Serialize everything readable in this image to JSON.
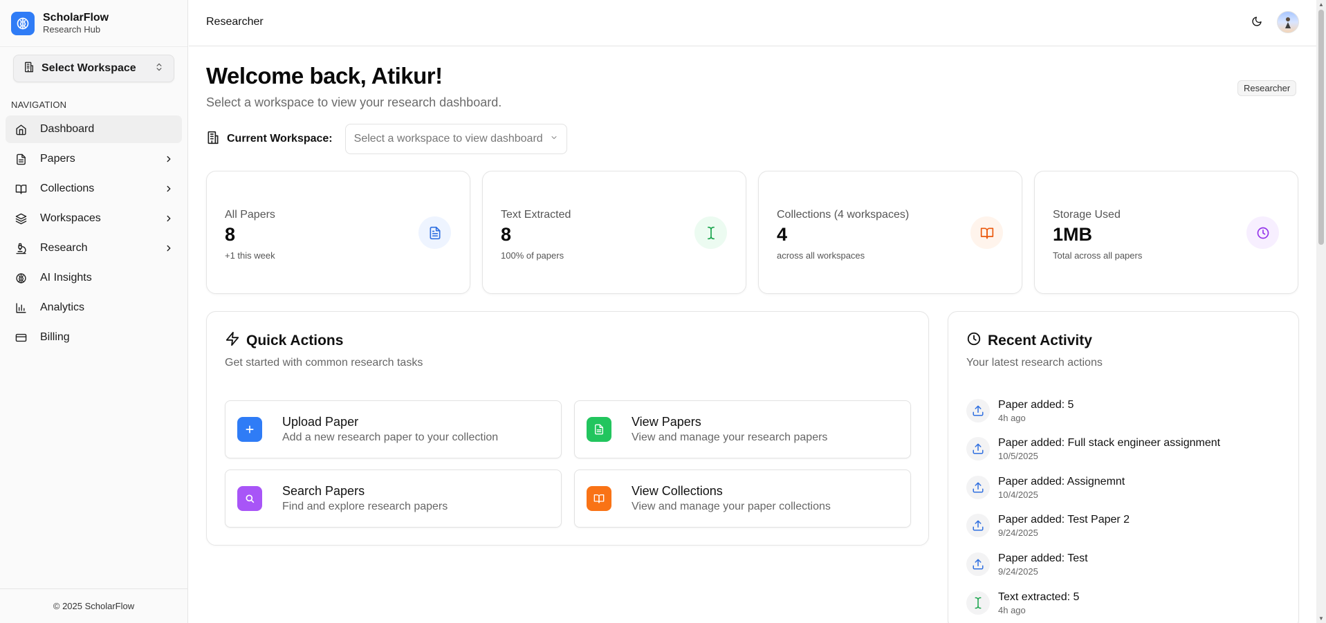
{
  "brand": {
    "name": "ScholarFlow",
    "subtitle": "Research Hub",
    "logo_icon": "brain-icon",
    "accent": "#2f7cf6"
  },
  "sidebar": {
    "workspace_select": "Select Workspace",
    "nav_heading": "NAVIGATION",
    "items": [
      {
        "label": "Dashboard",
        "icon": "home-icon",
        "active": true
      },
      {
        "label": "Papers",
        "icon": "file-icon",
        "expandable": true
      },
      {
        "label": "Collections",
        "icon": "book-icon",
        "expandable": true
      },
      {
        "label": "Workspaces",
        "icon": "layers-icon",
        "expandable": true
      },
      {
        "label": "Research",
        "icon": "microscope-icon",
        "expandable": true
      },
      {
        "label": "AI Insights",
        "icon": "brain-icon"
      },
      {
        "label": "Analytics",
        "icon": "bar-chart-icon"
      },
      {
        "label": "Billing",
        "icon": "credit-card-icon"
      }
    ],
    "footer": "© 2025 ScholarFlow"
  },
  "header": {
    "title": "Researcher",
    "theme_icon": "moon-icon"
  },
  "main": {
    "welcome": "Welcome back, Atikur!",
    "subtitle": "Select a workspace to view your research dashboard.",
    "role_badge": "Researcher",
    "current_workspace_label": "Current Workspace:",
    "current_workspace_placeholder": "Select a workspace to view dashboard",
    "stats": [
      {
        "label": "All Papers",
        "value": "8",
        "sub": "+1 this week",
        "icon": "file-text-icon",
        "color": "#2f6fe0",
        "bg": "#eef4ff"
      },
      {
        "label": "Text Extracted",
        "value": "8",
        "sub": "100% of papers",
        "icon": "text-cursor-icon",
        "color": "#16a34a",
        "bg": "#ecfbf1"
      },
      {
        "label": "Collections (4 workspaces)",
        "value": "4",
        "sub": "across all workspaces",
        "icon": "book-open-icon",
        "color": "#ea580c",
        "bg": "#fff4ec"
      },
      {
        "label": "Storage Used",
        "value": "1MB",
        "sub": "Total across all papers",
        "icon": "clock-icon",
        "color": "#9333ea",
        "bg": "#f7efff"
      }
    ],
    "quick_actions": {
      "title": "Quick Actions",
      "subtitle": "Get started with common research tasks",
      "items": [
        {
          "title": "Upload Paper",
          "desc": "Add a new research paper to your collection",
          "icon": "plus-icon",
          "color": "#2f7cf6"
        },
        {
          "title": "View Papers",
          "desc": "View and manage your research papers",
          "icon": "file-text-icon",
          "color": "#22c55e"
        },
        {
          "title": "Search Papers",
          "desc": "Find and explore research papers",
          "icon": "search-icon",
          "color": "#a855f7"
        },
        {
          "title": "View Collections",
          "desc": "View and manage your paper collections",
          "icon": "book-open-icon",
          "color": "#f97316"
        }
      ]
    },
    "recent_activity": {
      "title": "Recent Activity",
      "subtitle": "Your latest research actions",
      "items": [
        {
          "title": "Paper added: 5",
          "time": "4h ago",
          "icon": "upload-icon"
        },
        {
          "title": "Paper added: Full stack engineer assignment",
          "time": "10/5/2025",
          "icon": "upload-icon"
        },
        {
          "title": "Paper added: Assignemnt",
          "time": "10/4/2025",
          "icon": "upload-icon"
        },
        {
          "title": "Paper added: Test Paper 2",
          "time": "9/24/2025",
          "icon": "upload-icon"
        },
        {
          "title": "Paper added: Test",
          "time": "9/24/2025",
          "icon": "upload-icon"
        },
        {
          "title": "Text extracted: 5",
          "time": "4h ago",
          "icon": "text-cursor-icon"
        }
      ]
    }
  }
}
